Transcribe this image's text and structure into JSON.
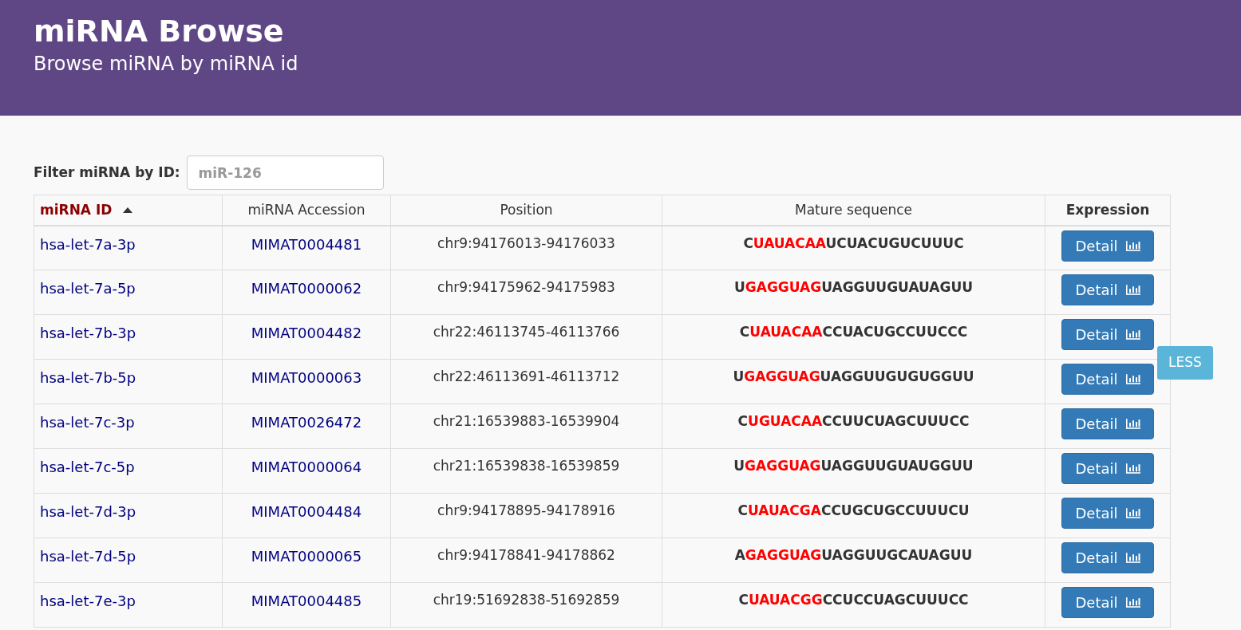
{
  "header": {
    "title": "miRNA Browse",
    "subtitle": "Browse miRNA by miRNA id"
  },
  "filter": {
    "label": "Filter miRNA by ID:",
    "placeholder": "miR-126"
  },
  "table": {
    "columns": [
      {
        "label": "miRNA ID",
        "sorted": true
      },
      {
        "label": "miRNA Accession",
        "sorted": false
      },
      {
        "label": "Position",
        "sorted": false
      },
      {
        "label": "Mature sequence",
        "sorted": false
      },
      {
        "label": "Expression",
        "sorted": false
      }
    ],
    "rows": [
      {
        "id": "hsa-let-7a-3p",
        "accession": "MIMAT0004481",
        "position": "chr9:94176013-94176033",
        "sequence": {
          "before": "C",
          "seed": "UAUACAA",
          "after": "UCUACUGUCUUUC"
        },
        "button": "Detail"
      },
      {
        "id": "hsa-let-7a-5p",
        "accession": "MIMAT0000062",
        "position": "chr9:94175962-94175983",
        "sequence": {
          "before": "U",
          "seed": "GAGGUAG",
          "after": "UAGGUUGUAUAGUU"
        },
        "button": "Detail"
      },
      {
        "id": "hsa-let-7b-3p",
        "accession": "MIMAT0004482",
        "position": "chr22:46113745-46113766",
        "sequence": {
          "before": "C",
          "seed": "UAUACAA",
          "after": "CCUACUGCCUUCCC"
        },
        "button": "Detail"
      },
      {
        "id": "hsa-let-7b-5p",
        "accession": "MIMAT0000063",
        "position": "chr22:46113691-46113712",
        "sequence": {
          "before": "U",
          "seed": "GAGGUAG",
          "after": "UAGGUUGUGUGGUU"
        },
        "button": "Detail"
      },
      {
        "id": "hsa-let-7c-3p",
        "accession": "MIMAT0026472",
        "position": "chr21:16539883-16539904",
        "sequence": {
          "before": "C",
          "seed": "UGUACAA",
          "after": "CCUUCUAGCUUUCC"
        },
        "button": "Detail"
      },
      {
        "id": "hsa-let-7c-5p",
        "accession": "MIMAT0000064",
        "position": "chr21:16539838-16539859",
        "sequence": {
          "before": "U",
          "seed": "GAGGUAG",
          "after": "UAGGUUGUAUGGUU"
        },
        "button": "Detail"
      },
      {
        "id": "hsa-let-7d-3p",
        "accession": "MIMAT0004484",
        "position": "chr9:94178895-94178916",
        "sequence": {
          "before": "C",
          "seed": "UAUACGA",
          "after": "CCUGCUGCCUUUCU"
        },
        "button": "Detail"
      },
      {
        "id": "hsa-let-7d-5p",
        "accession": "MIMAT0000065",
        "position": "chr9:94178841-94178862",
        "sequence": {
          "before": "A",
          "seed": "GAGGUAG",
          "after": "UAGGUUGCAUAGUU"
        },
        "button": "Detail"
      },
      {
        "id": "hsa-let-7e-3p",
        "accession": "MIMAT0004485",
        "position": "chr19:51692838-51692859",
        "sequence": {
          "before": "C",
          "seed": "UAUACGG",
          "after": "CCUCCUAGCUUUCC"
        },
        "button": "Detail"
      }
    ]
  },
  "overlay_button": {
    "label": "LESS"
  }
}
